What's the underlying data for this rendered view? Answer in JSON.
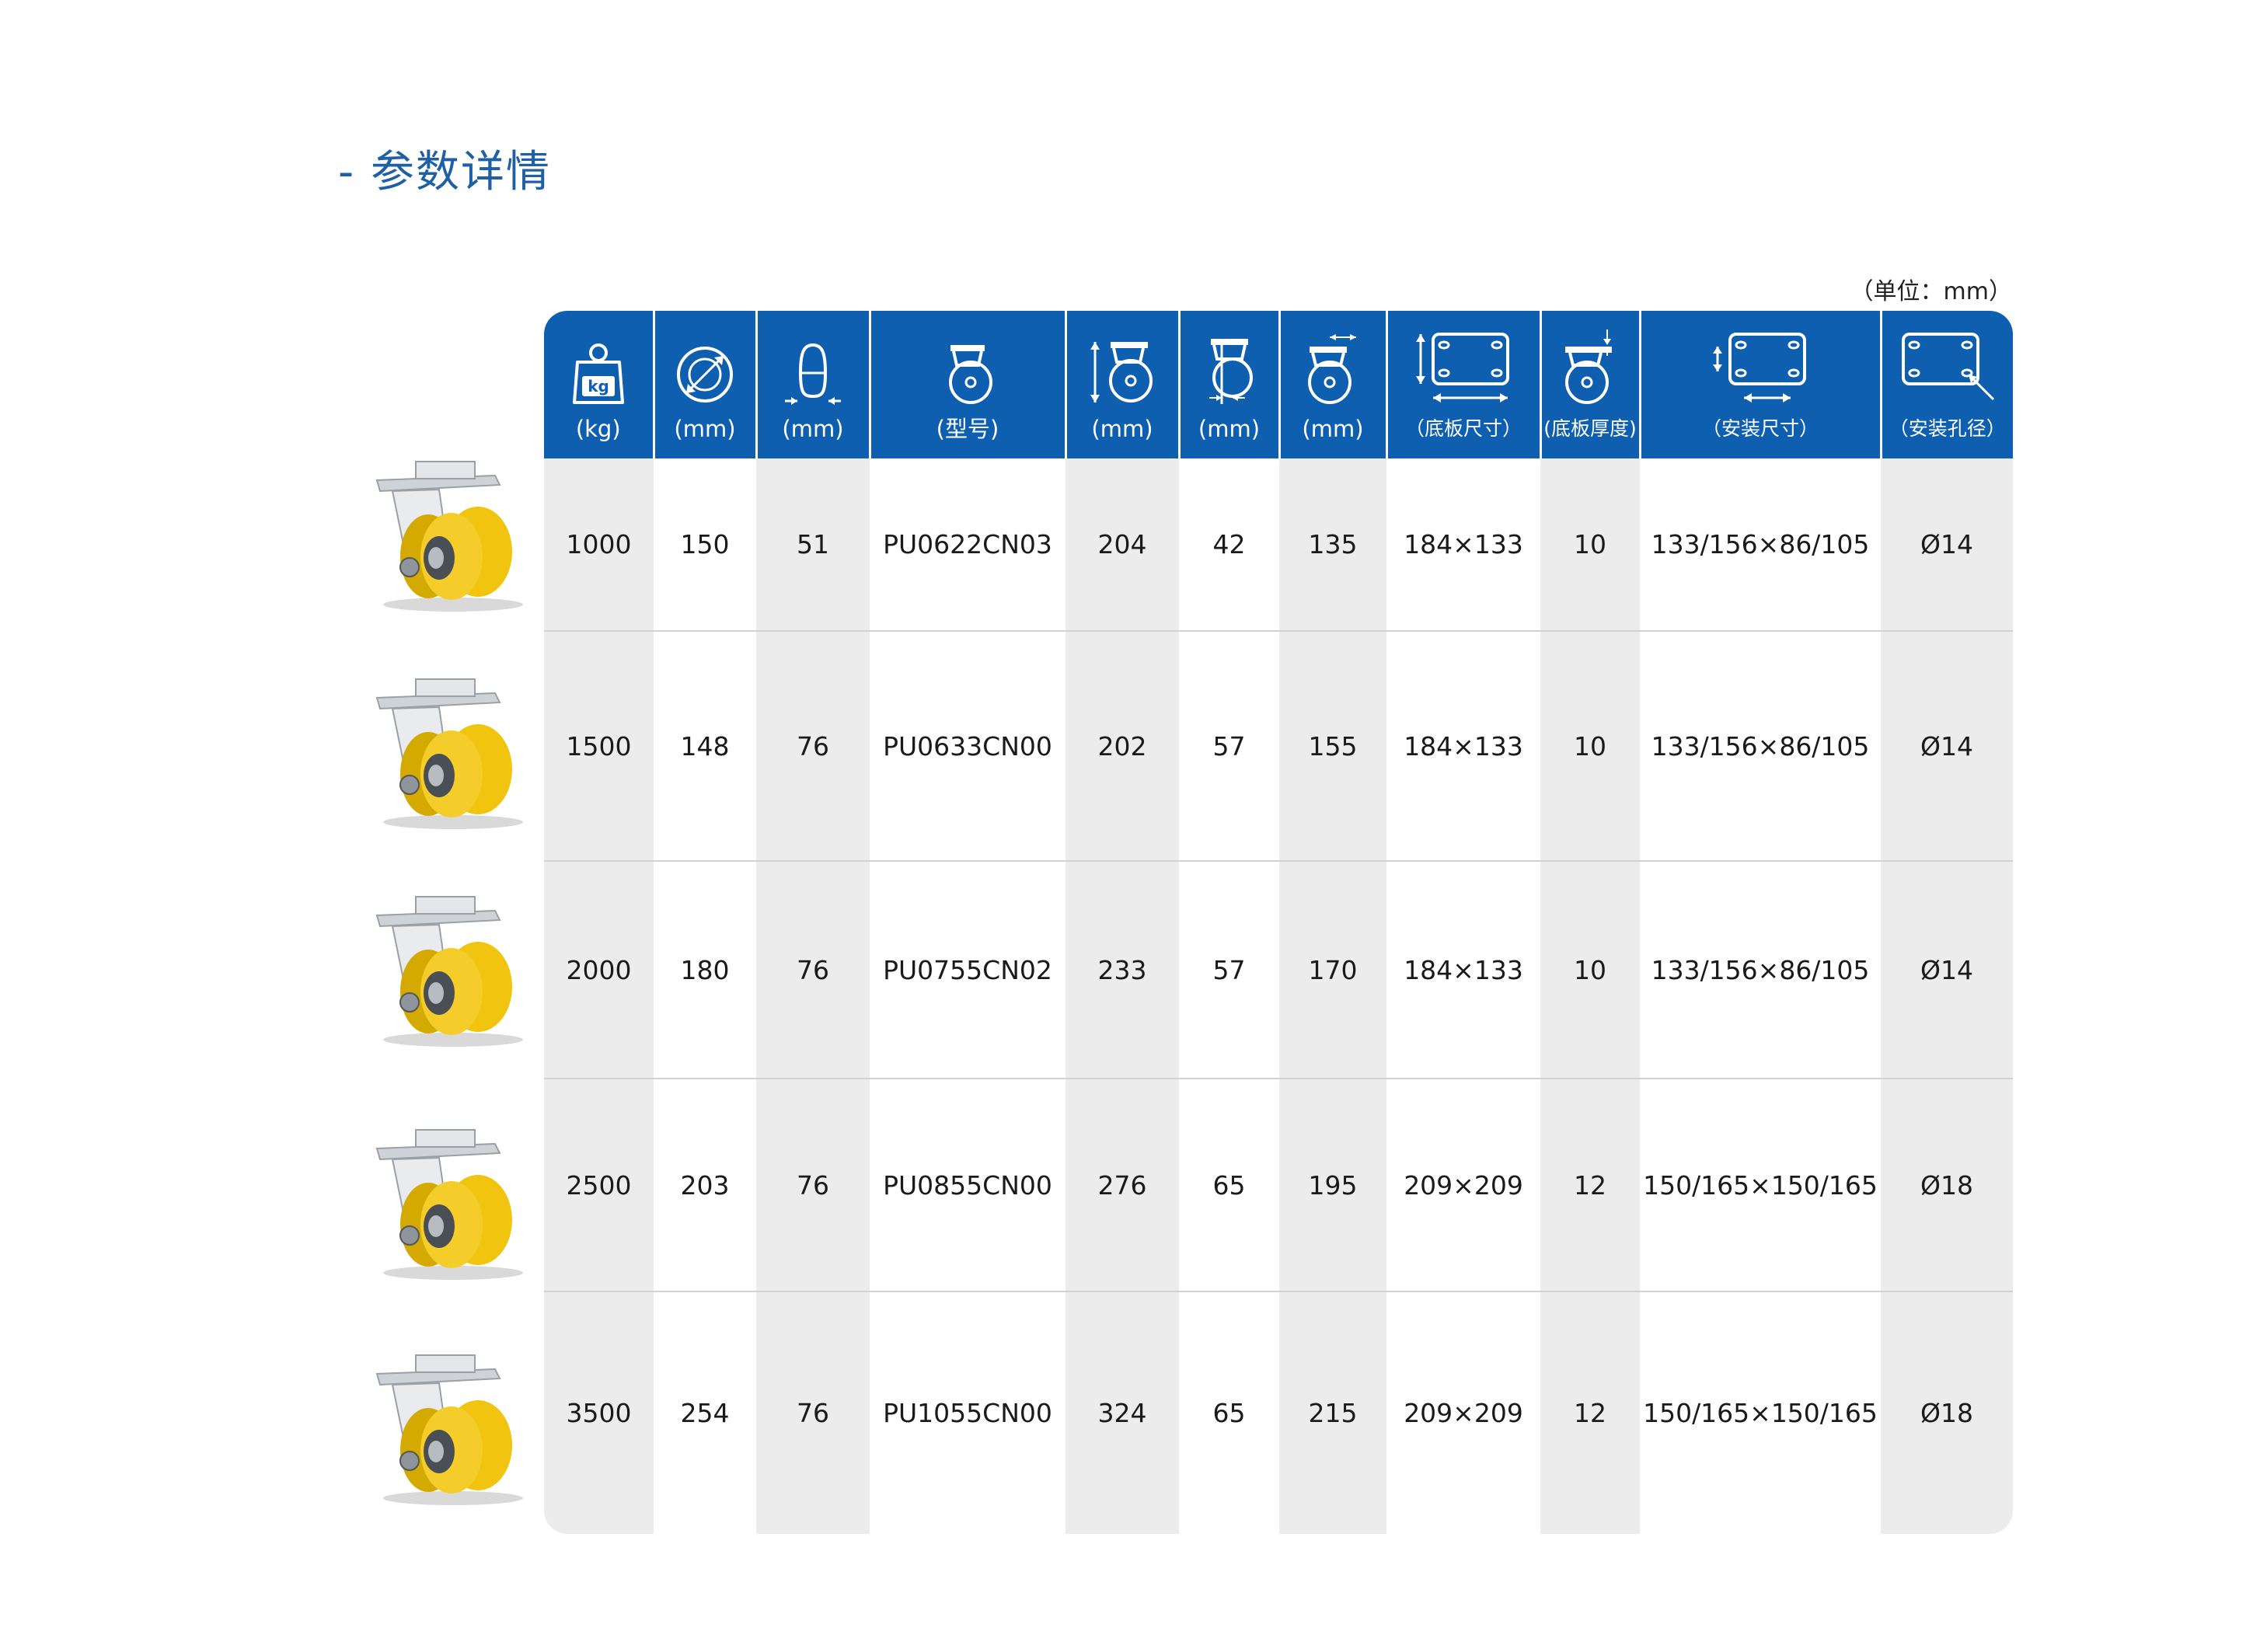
{
  "title": "- 参数详情",
  "unit_note": "（单位：mm）",
  "header": {
    "columns": [
      {
        "icon": "load-weight-icon",
        "label": "(kg)"
      },
      {
        "icon": "wheel-diameter-icon",
        "label": "(mm)"
      },
      {
        "icon": "wheel-width-icon",
        "label": "(mm)"
      },
      {
        "icon": "model-caster-icon",
        "label": "(型号)"
      },
      {
        "icon": "total-height-icon",
        "label": "(mm)"
      },
      {
        "icon": "offset-icon",
        "label": "(mm)"
      },
      {
        "icon": "swivel-radius-icon",
        "label": "(mm)"
      },
      {
        "icon": "plate-size-icon",
        "label": "（底板尺寸）"
      },
      {
        "icon": "plate-thickness-icon",
        "label": "(底板厚度)"
      },
      {
        "icon": "mounting-size-icon",
        "label": "（安装尺寸）"
      },
      {
        "icon": "bolt-hole-icon",
        "label": "（安装孔径）"
      }
    ]
  },
  "rows": [
    [
      "1000",
      "150",
      "51",
      "PU0622CN03",
      "204",
      "42",
      "135",
      "184×133",
      "10",
      "133/156×86/105",
      "Ø14"
    ],
    [
      "1500",
      "148",
      "76",
      "PU0633CN00",
      "202",
      "57",
      "155",
      "184×133",
      "10",
      "133/156×86/105",
      "Ø14"
    ],
    [
      "2000",
      "180",
      "76",
      "PU0755CN02",
      "233",
      "57",
      "170",
      "184×133",
      "10",
      "133/156×86/105",
      "Ø14"
    ],
    [
      "2500",
      "203",
      "76",
      "PU0855CN00",
      "276",
      "65",
      "195",
      "209×209",
      "12",
      "150/165×150/165",
      "Ø18"
    ],
    [
      "3500",
      "254",
      "76",
      "PU1055CN00",
      "324",
      "65",
      "215",
      "209×209",
      "12",
      "150/165×150/165",
      "Ø18"
    ]
  ],
  "kg_badge": "kg",
  "colors": {
    "header_blue": "#0f5fb0",
    "title_blue": "#1f5fa6",
    "wheel_yellow": "#f1c40f",
    "row_gray": "#ececed"
  }
}
